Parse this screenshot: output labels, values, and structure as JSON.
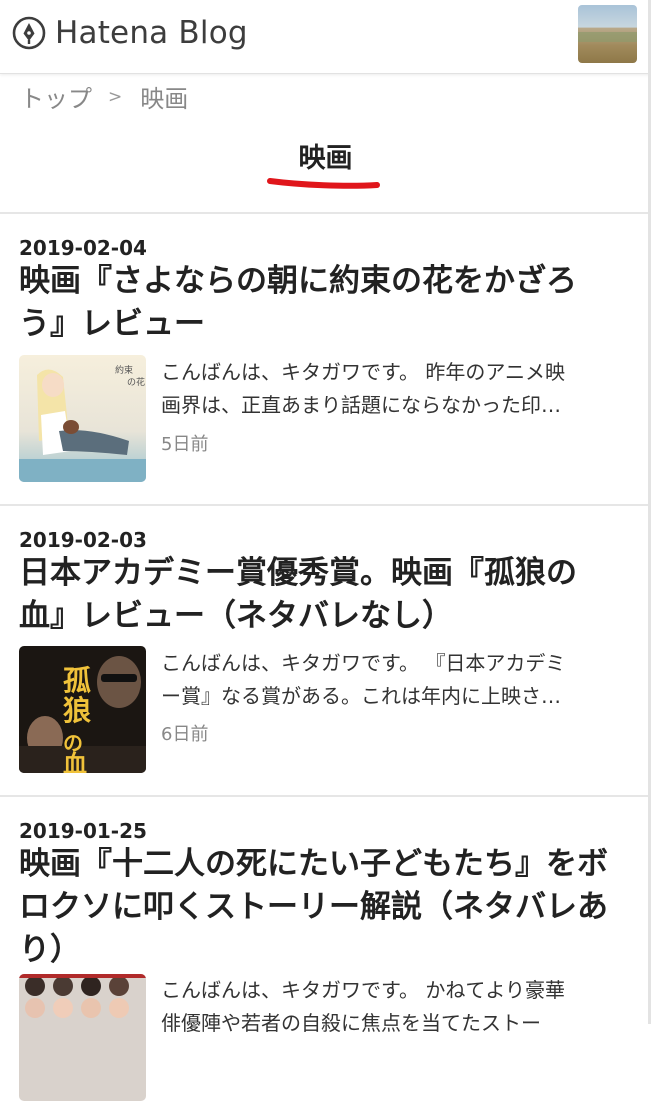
{
  "header": {
    "logo_text": "Hatena Blog",
    "logo_icon": "pen-nib-icon",
    "avatar": "user-avatar-image"
  },
  "breadcrumb": {
    "home": "トップ",
    "separator": ">",
    "current": "映画"
  },
  "category_title": "映画",
  "accent_color": "#e0161b",
  "entries": [
    {
      "date": "2019-02-04",
      "title_lines": [
        "映画『さよならの朝に約束の花をかざろ",
        "う』レビュー"
      ],
      "summary_lines": [
        "こんばんは、キタガワです。 昨年のアニメ映",
        "画界は、正直あまり話題にならなかった印…"
      ],
      "ago": "5日前"
    },
    {
      "date": "2019-02-03",
      "title_lines": [
        "日本アカデミー賞優秀賞。映画『孤狼の",
        "血』レビュー（ネタバレなし）"
      ],
      "summary_lines": [
        "こんばんは、キタガワです。 『日本アカデミ",
        "ー賞』なる賞がある。これは年内に上映さ…"
      ],
      "ago": "6日前"
    },
    {
      "date": "2019-01-25",
      "title_lines": [
        "映画『十二人の死にたい子どもたち』をボ",
        "ロクソに叩くストーリー解説（ネタバレあ",
        "り）"
      ],
      "summary_lines": [
        "こんばんは、キタガワです。 かねてより豪華",
        "俳優陣や若者の自殺に焦点を当てたストー"
      ]
    }
  ]
}
